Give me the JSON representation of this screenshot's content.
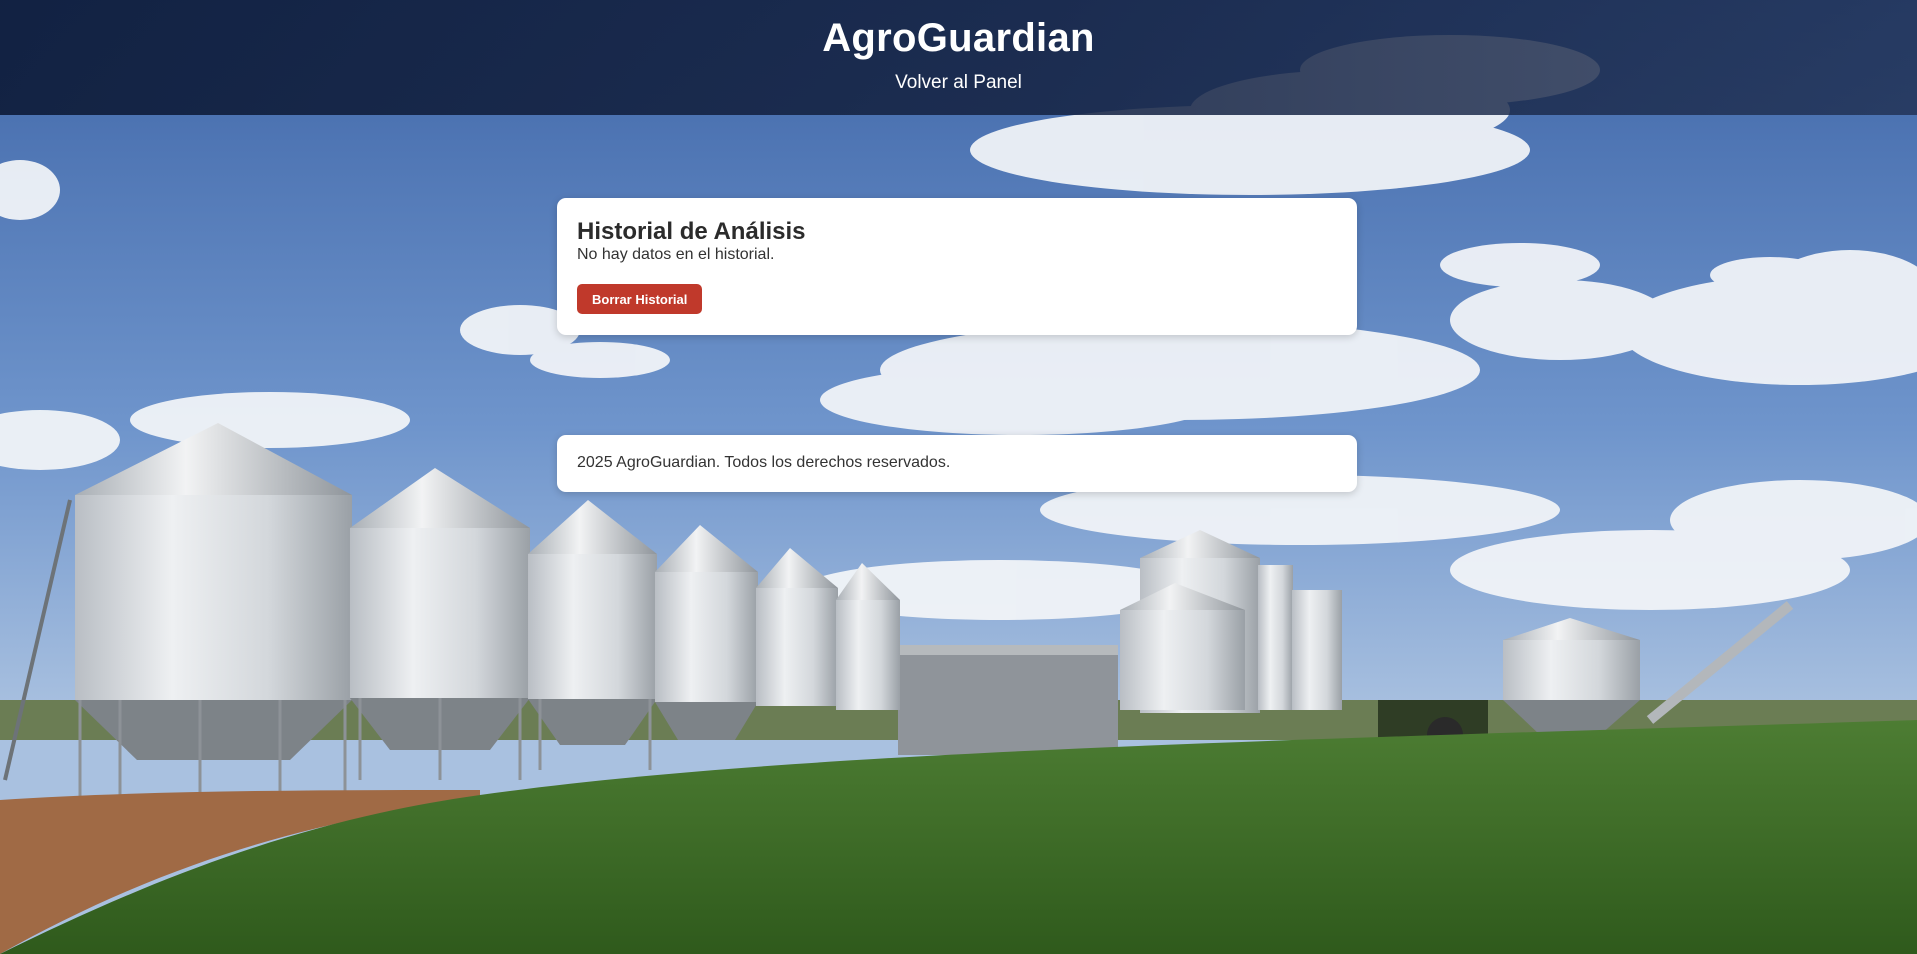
{
  "header": {
    "title": "AgroGuardian",
    "back_link": "Volver al Panel"
  },
  "history": {
    "title": "Historial de Análisis",
    "empty_message": "No hay datos en el historial.",
    "clear_button": "Borrar Historial"
  },
  "footer": {
    "text": "2025 AgroGuardian. Todos los derechos reservados."
  },
  "colors": {
    "header_bg": "#16243f",
    "button_bg": "#c0392b",
    "card_bg": "#ffffff",
    "text": "#333333"
  },
  "background": {
    "icon": "grain-silos-farm-photo"
  }
}
